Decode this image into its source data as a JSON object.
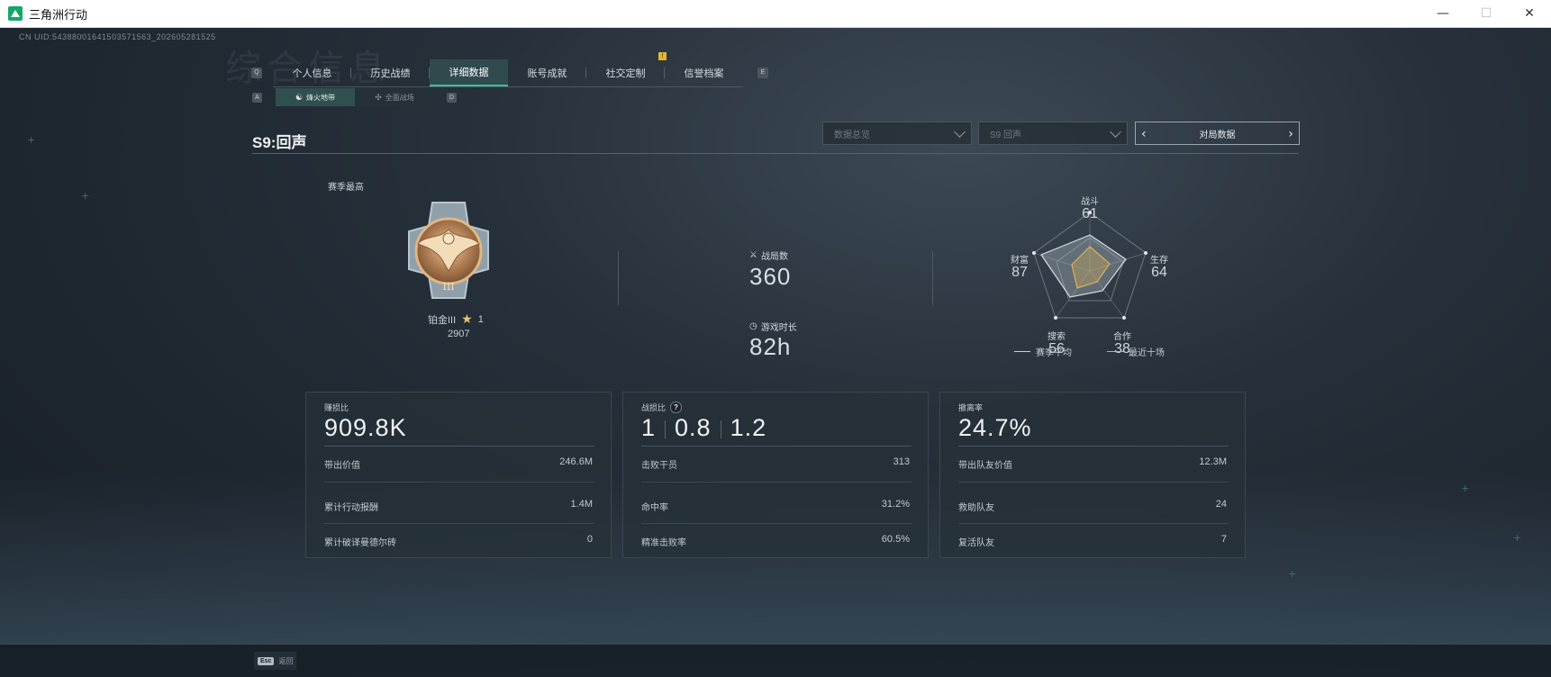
{
  "window": {
    "title": "三角洲行动",
    "minimize": "—",
    "maximize": "☐",
    "close": "✕"
  },
  "uid": "CN UID:543880016415035715​63_202605281525",
  "background_title": "综合信息",
  "tabs": [
    {
      "label": "个人信息",
      "active": false
    },
    {
      "label": "历史战绩",
      "active": false
    },
    {
      "label": "详细数据",
      "active": true
    },
    {
      "label": "账号成就",
      "active": false
    },
    {
      "label": "社交定制",
      "active": false,
      "badge": "!"
    },
    {
      "label": "信誉档案",
      "active": false
    }
  ],
  "tab_keys": {
    "left": "Q",
    "right": "E"
  },
  "subtabs": [
    {
      "label": "烽火地带",
      "icon": "mode-icon",
      "active": true
    },
    {
      "label": "全面战场",
      "icon": "mode-icon",
      "active": false
    }
  ],
  "subtab_keys": {
    "left": "A",
    "right": "D"
  },
  "season_title": "S9:回声",
  "filters": {
    "data_select": "数据总览",
    "season_select": "S9 回声",
    "match_data": "对局数据"
  },
  "rank": {
    "best_label": "赛季最高",
    "name": "铂金III",
    "stars": "1",
    "score": "2907",
    "medal_numeral": "III"
  },
  "stats": {
    "matches_label": "战局数",
    "matches_value": "360",
    "playtime_label": "游戏时长",
    "playtime_value": "82h"
  },
  "radar": {
    "axes": [
      {
        "label": "战斗",
        "value": "61"
      },
      {
        "label": "生存",
        "value": "64"
      },
      {
        "label": "合作",
        "value": "38"
      },
      {
        "label": "搜索",
        "value": "56"
      },
      {
        "label": "财富",
        "value": "87"
      }
    ],
    "legend_season": "赛季平均",
    "legend_recent": "最近十场",
    "colors": {
      "season": "#c9d2da",
      "recent": "#d9b25a"
    }
  },
  "cards": [
    {
      "title": "赚损比",
      "big": "909.8K",
      "rows": [
        {
          "label": "带出价值",
          "value": "246.6M"
        },
        {
          "label": "累计行动报酬",
          "value": "1.4M"
        },
        {
          "label": "累计破译曼德尔砖",
          "value": "0"
        }
      ]
    },
    {
      "title": "战损比",
      "help": "?",
      "big_parts": [
        "1",
        "0.8",
        "1.2"
      ],
      "rows": [
        {
          "label": "击败干员",
          "value": "313"
        },
        {
          "label": "命中率",
          "value": "31.2%"
        },
        {
          "label": "精准击败率",
          "value": "60.5%"
        }
      ]
    },
    {
      "title": "撤离率",
      "big": "24.7%",
      "rows": [
        {
          "label": "带出队友价值",
          "value": "12.3M"
        },
        {
          "label": "救助队友",
          "value": "24"
        },
        {
          "label": "复活队友",
          "value": "7"
        }
      ]
    }
  ],
  "footer": {
    "esc_key": "Esc",
    "esc_label": "返回"
  },
  "colors": {
    "accent": "#37c49a",
    "gold": "#e6c873",
    "badge": "#e5b62c"
  }
}
